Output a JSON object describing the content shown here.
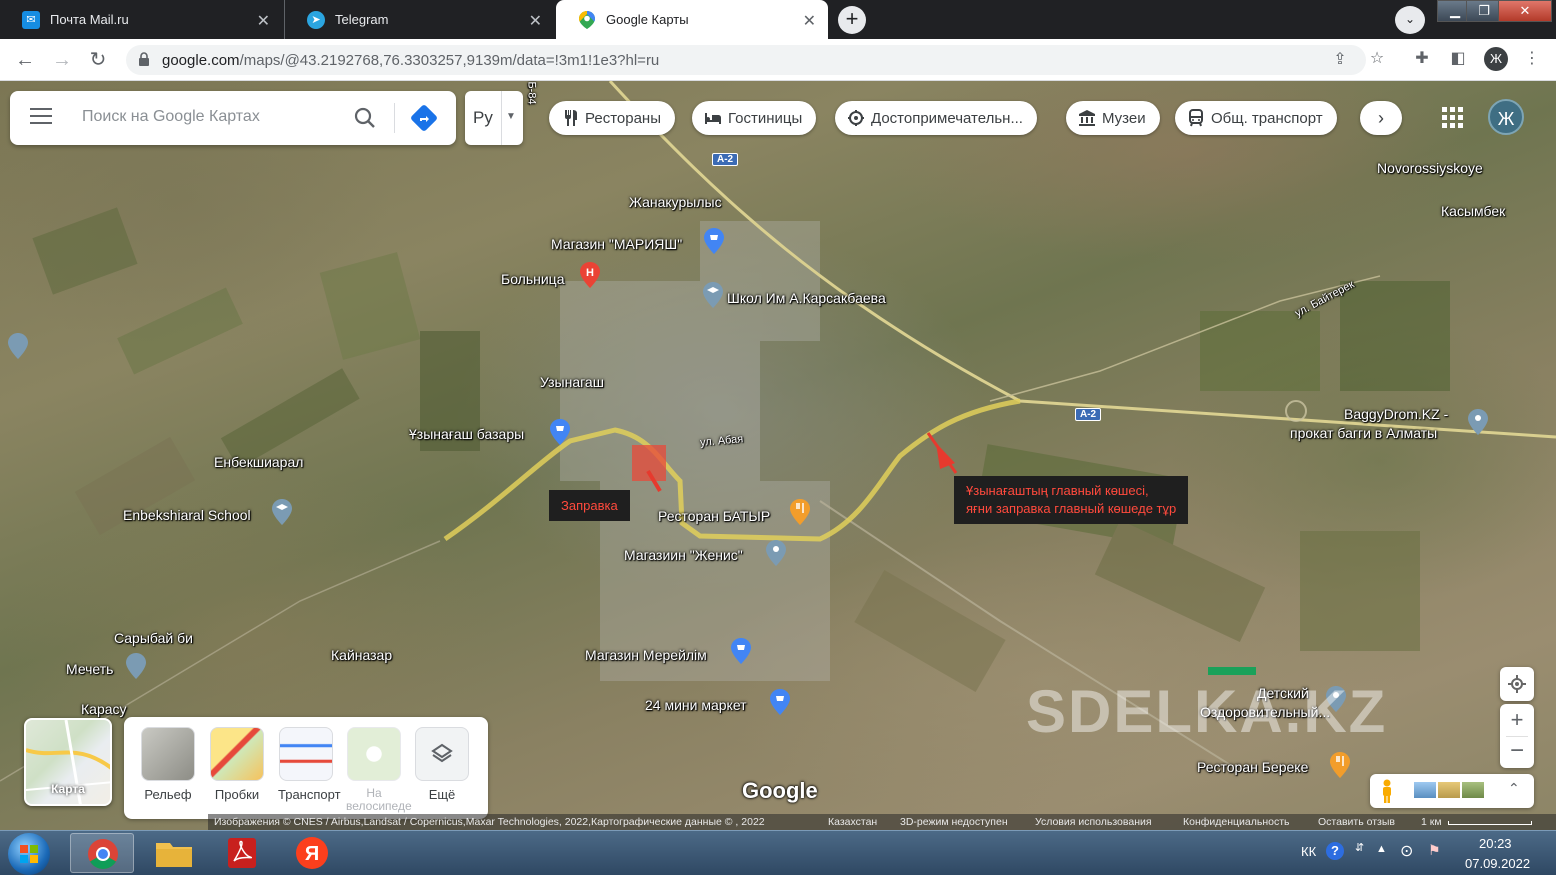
{
  "browser": {
    "tabs": [
      {
        "title": "Почта Mail.ru",
        "icon": "mail-icon"
      },
      {
        "title": "Telegram",
        "icon": "telegram-icon"
      },
      {
        "title": "Google Карты",
        "icon": "google-maps-icon"
      }
    ],
    "url_host": "google.com",
    "url_path": "/maps/@43.2192768,76.3303257,9139m/data=!3m1!1e3?hl=ru",
    "profile_letter": "Ж"
  },
  "maps": {
    "search_placeholder": "Поиск на Google Картах",
    "language": "Ру",
    "chips": [
      {
        "label": "Рестораны",
        "icon": "restaurant-icon"
      },
      {
        "label": "Гостиницы",
        "icon": "hotel-icon"
      },
      {
        "label": "Достопримечательн...",
        "icon": "attraction-icon"
      },
      {
        "label": "Музеи",
        "icon": "museum-icon"
      },
      {
        "label": "Общ. транспорт",
        "icon": "transit-icon"
      }
    ],
    "avatar_letter": "Ж",
    "place_labels": {
      "zhanakurylys": "Жанакурылыс",
      "mariyash": "Магазин \"МАРИЯШ\"",
      "hospital": "Больница",
      "school_karsak": "Школ Им А.Карсакбаева",
      "uzynagash": "Узынагаш",
      "bazaar": "Ұзынағаш базары",
      "enbekshiaral": "Енбекшиарал",
      "enbek_school": "Enbekshiaral School",
      "restaurant_batyr": "Ресторан БАТЫР",
      "zhenis": "Магазиин \"Женис\"",
      "sarybay": "Сарыбай би",
      "mosque": "Мечеть",
      "kainazar": "Кайназар",
      "karasu": "Карасу",
      "mereilim": "Магазин Мерейлім",
      "mini_market": "24 мини маркет",
      "novorossiyskoye": "Novorossiyskoye",
      "kasymbek": "Касымбек",
      "baggydrom_1": "BaggyDrom.KZ -",
      "baggydrom_2": "прокат багги в Алматы",
      "detsky_1": "Детский",
      "detsky_2": "Оздоровительный...",
      "bereke": "Ресторан Береке",
      "street_abaya": "ул. Абая",
      "street_baiterek": "ул. Байтерек",
      "road_a2": "A-2",
      "road_b4": "Б-84"
    },
    "annotation_small": "Заправка",
    "annotation_big_1": "Ұзынағаштың главный көшесі,",
    "annotation_big_2": "яғни заправка главный көшеде тұр",
    "layers": {
      "current": "Карта",
      "items": [
        {
          "label": "Рельеф",
          "enabled": true
        },
        {
          "label": "Пробки",
          "enabled": true
        },
        {
          "label": "Транспорт",
          "enabled": true
        },
        {
          "label": "На велосипеде",
          "enabled": false
        },
        {
          "label": "Ещё",
          "enabled": true
        }
      ]
    },
    "google_logo": "Google",
    "watermark": "SDELKA.KZ",
    "attribution": {
      "imagery": "Изображения © CNES / Airbus,Landsat / Copernicus,Maxar Technologies, 2022,Картографические данные © , 2022",
      "country": "Казахстан",
      "three_d": "3D-режим недоступен",
      "terms": "Условия использования",
      "privacy": "Конфиденциальность",
      "feedback": "Оставить отзыв",
      "scale": "1 км"
    }
  },
  "taskbar": {
    "lang": "КК",
    "time": "20:23",
    "date": "07.09.2022"
  }
}
